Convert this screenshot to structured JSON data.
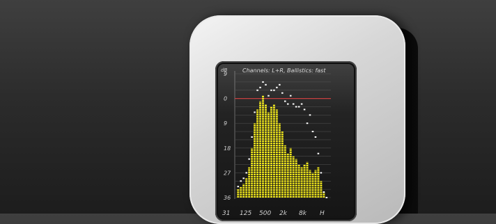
{
  "display": {
    "db_unit": "dB",
    "header": "Channels: L+R, Ballistics: fast",
    "y_ticks": [
      "9",
      "0",
      "9",
      "18",
      "27",
      "36"
    ],
    "x_ticks": [
      "31",
      "125",
      "500",
      "2k",
      "8k",
      "H"
    ]
  },
  "chart_data": {
    "type": "bar",
    "title": "Channels: L+R, Ballistics: fast",
    "ylabel": "dB",
    "y_tick_labels": [
      "9",
      "0",
      "9",
      "18",
      "27",
      "36"
    ],
    "x_tick_labels": [
      "31",
      "125",
      "500",
      "2k",
      "8k",
      "H"
    ],
    "reference_line_db": 0,
    "bar_level_db": [
      -33,
      -32,
      -31,
      -29,
      -25,
      -18,
      -9,
      -4,
      -1,
      1,
      -2,
      -5,
      -3,
      -2,
      -4,
      -9,
      -12,
      -17,
      -20,
      -18,
      -21,
      -22,
      -24,
      -25,
      -24,
      -23,
      -26,
      -27,
      -26,
      -25,
      -30,
      -34,
      -36
    ],
    "peak_level_db": [
      -32,
      -30,
      -29,
      -27,
      -22,
      -14,
      -5,
      3,
      4,
      6,
      5,
      1,
      3,
      3,
      4,
      5,
      2,
      -1,
      -2,
      1,
      -2,
      -3,
      -3,
      -2,
      -4,
      -9,
      -6,
      -12,
      -14,
      -20,
      -27,
      -34,
      -36
    ],
    "colors": {
      "bars": "#f3ea1b",
      "peaks": "#ffffff",
      "reference_line": "#c43a3a",
      "grid": "#4a4a4a"
    }
  }
}
